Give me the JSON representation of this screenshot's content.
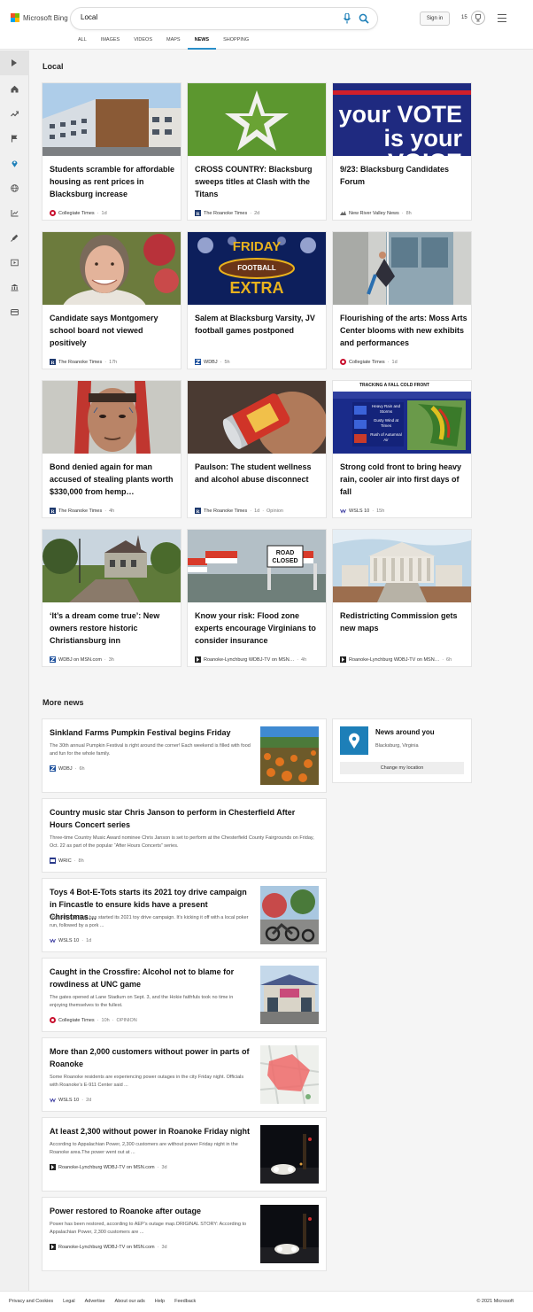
{
  "header": {
    "brand": "Microsoft Bing",
    "search_value": "Local",
    "signin_label": "Sign in",
    "rewards_count": "15",
    "tabs": [
      {
        "label": "ALL"
      },
      {
        "label": "IMAGES"
      },
      {
        "label": "VIDEOS"
      },
      {
        "label": "MAPS"
      },
      {
        "label": "NEWS",
        "active": true
      },
      {
        "label": "SHOPPING"
      }
    ],
    "accent_color": "#2a8ec9"
  },
  "sidebar": {
    "icons": [
      "expand-icon",
      "home-icon",
      "trending-icon",
      "flag-icon",
      "location-icon",
      "globe-icon",
      "money-icon",
      "science-icon",
      "entertainment-icon",
      "politics-icon",
      "sports-icon"
    ]
  },
  "local": {
    "section_title": "Local",
    "cards": [
      {
        "title": "Students scramble for affordable housing as rent prices in Blacksburg increase",
        "source": "Collegiate Times",
        "time": "1d",
        "extra": "",
        "image": "apartment-building"
      },
      {
        "title": "CROSS COUNTRY: Blacksburg sweeps titles at Clash with the Titans",
        "source": "The Roanoke Times",
        "time": "2d",
        "extra": "",
        "image": "grass-star"
      },
      {
        "title": "9/23: Blacksburg Candidates Forum",
        "source": "New River Valley News",
        "time": "8h",
        "extra": "",
        "image": "vote-banner",
        "banner_line1": "your VOTE",
        "banner_line2": "is your VOICE"
      },
      {
        "title": "Candidate says Montgomery school board not viewed positively",
        "source": "The Roanoke Times",
        "time": "17h",
        "extra": "",
        "image": "portrait-woman"
      },
      {
        "title": "Salem at Blacksburg Varsity, JV football games postponed",
        "source": "WDBJ",
        "time": "5h",
        "extra": "",
        "image": "friday-football",
        "banner_line1": "FRIDAY",
        "banner_line2": "FOOTBALL",
        "banner_line3": "EXTRA"
      },
      {
        "title": "Flourishing of the arts: Moss Arts Center blooms with new exhibits and performances",
        "source": "Collegiate Times",
        "time": "1d",
        "extra": "",
        "image": "aerial-dancer"
      },
      {
        "title": "Bond denied again for man accused of stealing plants worth $330,000 from hemp…",
        "source": "The Roanoke Times",
        "time": "4h",
        "extra": "",
        "image": "mugshot"
      },
      {
        "title": "Paulson: The student wellness and alcohol abuse disconnect",
        "source": "The Roanoke Times",
        "time": "1d",
        "extra": "Opinion",
        "image": "beer-can"
      },
      {
        "title": "Strong cold front to bring heavy rain, cooler air into first days of fall",
        "source": "WSLS 10",
        "time": "15h",
        "extra": "",
        "image": "weather-map",
        "banner_line1": "TRACKING A FALL COLD FRONT",
        "banner_line2": "Heavy Rain and Storms",
        "banner_line3": "Gusty Wind at Times",
        "banner_line4": "Rush of Autumnal Air"
      },
      {
        "title": "‘It’s a dream come true’: New owners restore historic Christiansburg inn",
        "source": "WDBJ on MSN.com",
        "time": "3h",
        "extra": "",
        "image": "victorian-inn"
      },
      {
        "title": "Know your risk: Flood zone experts encourage Virginians to consider insurance",
        "source": "Roanoke-Lynchburg WDBJ-TV on MSN…",
        "time": "4h",
        "extra": "",
        "image": "road-closed",
        "banner_line1": "ROAD",
        "banner_line2": "CLOSED"
      },
      {
        "title": "Redistricting Commission gets new maps",
        "source": "Roanoke-Lynchburg WDBJ-TV on MSN…",
        "time": "6h",
        "extra": "",
        "image": "capitol-building"
      }
    ]
  },
  "more_news": {
    "section_title": "More news",
    "items": [
      {
        "title": "Sinkland Farms Pumpkin Festival begins Friday",
        "snippet": "The 30th annual Pumpkin Festival is right around the corner! Each weekend is filled with food and fun for the whole family.",
        "source": "WDBJ",
        "time": "6h",
        "extra": "",
        "image": "pumpkin-field"
      },
      {
        "title": "Country music star Chris Janson to perform in Chesterfield After Hours Concert series",
        "snippet": "Three-time Country Music Award nominee Chris Janson is set to perform at the Chesterfield County Fairgrounds on Friday, Oct. 22 as part of the popular “After Hours Concerts” series.",
        "source": "WRIC",
        "time": "8h",
        "extra": "",
        "image": ""
      },
      {
        "title": "Toys 4 Bot-E-Tots starts its 2021 toy drive campaign in Fincastle to ensure kids have a present Christmas…",
        "snippet": "Toys 4 Bot-E-Tots has started its 2021 toy drive campaign. It’s kicking it off with a local poker run, followed by a pork ...",
        "source": "WSLS 10",
        "time": "1d",
        "extra": "",
        "image": "motorcycles"
      },
      {
        "title": "Caught in the Crossfire: Alcohol not to blame for rowdiness at UNC game",
        "snippet": "The gates opened at Lane Stadium on Sept. 3, and the Hokie faithfuls took no time in enjoying themselves to the fullest.",
        "source": "Collegiate Times",
        "time": "10h",
        "extra": "OPINION",
        "image": "storefront"
      },
      {
        "title": "More than 2,000 customers without power in parts of Roanoke",
        "snippet": "Some Roanoke residents are experiencing power outages in the city Friday night. Officials with Roanoke’s E-911 Center said ...",
        "source": "WSLS 10",
        "time": "2d",
        "extra": "",
        "image": "outage-map"
      },
      {
        "title": "At least 2,300 without power in Roanoke Friday night",
        "snippet": "According to Appalachian Power, 2,300 customers are without power Friday night in the Roanoke area.The power went out at ...",
        "source": "Roanoke-Lynchburg WDBJ-TV on MSN.com",
        "time": "3d",
        "extra": "",
        "image": "night-street"
      },
      {
        "title": "Power restored to Roanoke after outage",
        "snippet": "Power has been restored, according to AEP’s outage map.ORIGINAL STORY: According to Appalachian Power, 2,300 customers are ...",
        "source": "Roanoke-Lynchburg WDBJ-TV on MSN.com",
        "time": "3d",
        "extra": "",
        "image": "night-street"
      }
    ]
  },
  "news_around": {
    "title": "News around you",
    "location": "Blacksburg, Virginia",
    "button": "Change my location"
  },
  "footer": {
    "links": [
      "Privacy and Cookies",
      "Legal",
      "Advertise",
      "About our ads",
      "Help",
      "Feedback"
    ],
    "copyright": "© 2021 Microsoft"
  }
}
